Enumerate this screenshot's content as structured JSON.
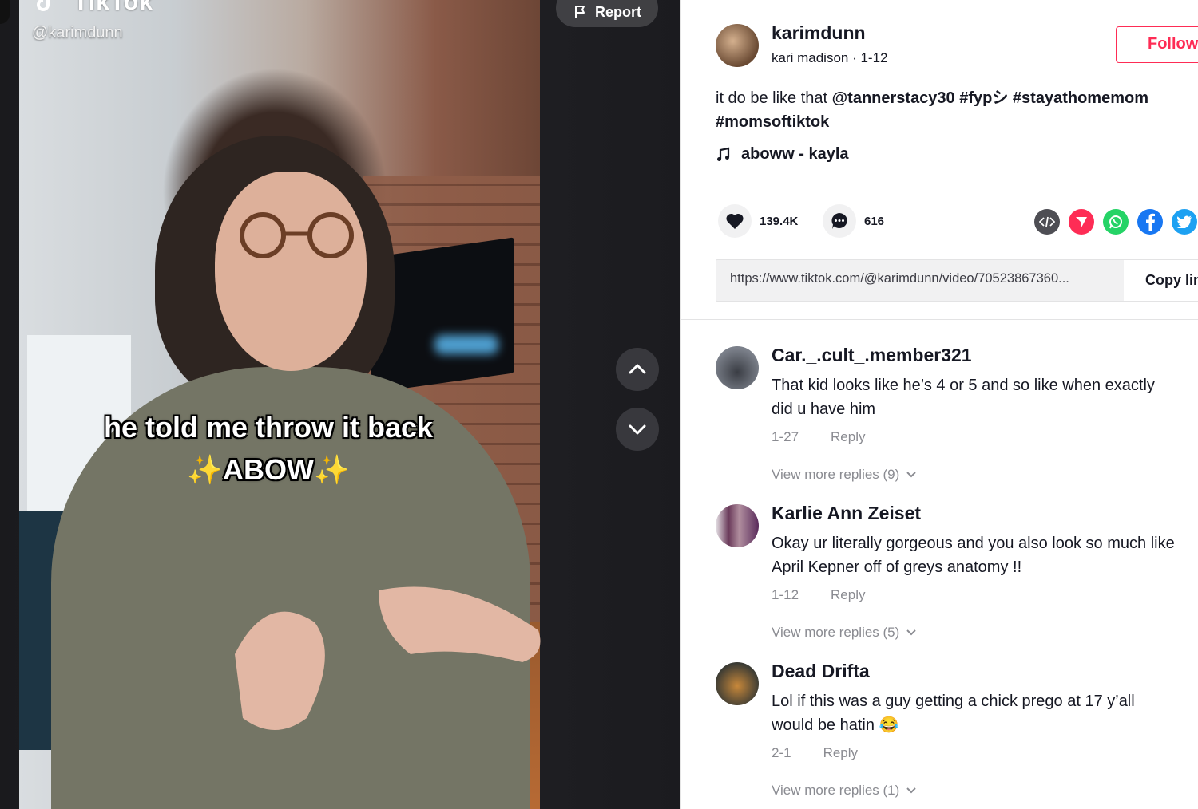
{
  "video": {
    "brand": "TikTok",
    "handle": "@karimdunn",
    "caption_line1": "he told me throw it back",
    "caption_line2_text": "ABOW",
    "caption_sparkles": "✨",
    "report_label": "Report"
  },
  "author": {
    "username": "karimdunn",
    "meta": "kari madison · 1-12",
    "follow_label": "Follow"
  },
  "description": {
    "text": "it do be like that ",
    "mention": "@tannerstacy30",
    "tags": " #fypシ #stayathomemom #momsoftiktok"
  },
  "music": {
    "title": "aboww - kayla"
  },
  "stats": {
    "likes": "139.4K",
    "comments": "616"
  },
  "share": {
    "icons": [
      "embed-icon",
      "send-icon",
      "whatsapp-icon",
      "facebook-icon",
      "twitter-icon"
    ],
    "colors": {
      "embed": "#4e4e54",
      "send": "#fe2c55",
      "whatsapp": "#25d366",
      "facebook": "#1877f2",
      "twitter": "#1da1f2"
    }
  },
  "link": {
    "url": "https://www.tiktok.com/@karimdunn/video/70523867360...",
    "copy_label": "Copy link"
  },
  "comments": [
    {
      "user": "Car._.cult_.member321",
      "text": "That kid looks like he’s 4 or 5 and so like when exactly did u have him",
      "date": "1-27",
      "reply_label": "Reply",
      "more": "View more replies (9)"
    },
    {
      "user": "Karlie Ann Zeiset",
      "text": "Okay ur literally gorgeous and you also look so much like April Kepner off of greys anatomy !!",
      "date": "1-12",
      "reply_label": "Reply",
      "more": "View more replies (5)"
    },
    {
      "user": "Dead Drifta",
      "text": "Lol if this was a guy getting a chick prego at 17 y’all would be hatin 😂",
      "date": "2-1",
      "reply_label": "Reply",
      "more": "View more replies (1)"
    }
  ],
  "colors": {
    "accent": "#fe2c55",
    "text": "#161823",
    "muted": "#8a8b91"
  }
}
